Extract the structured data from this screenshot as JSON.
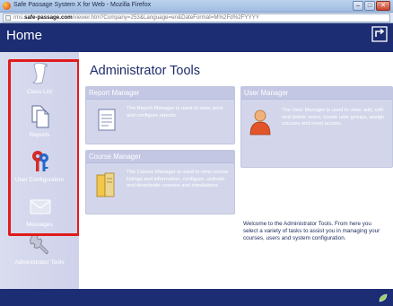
{
  "window": {
    "title": "Safe Passage System X for Web - Mozilla Firefox",
    "buttons": [
      "–",
      "□",
      "✕"
    ]
  },
  "urlbar": {
    "prefix": "rms.",
    "domain": "safe-passage.com",
    "path": "/viewer.htm?Company=253&Language=en&DateFormat=M%2Fd%2FYYYY"
  },
  "header": {
    "title": "Home",
    "exit_icon": "exit-arrow-icon"
  },
  "sidebar": {
    "items": [
      {
        "label": "Class List",
        "icon": "scroll-icon"
      },
      {
        "label": "Reports",
        "icon": "documents-icon"
      },
      {
        "label": "User Configuration",
        "icon": "users-keys-icon"
      },
      {
        "label": "Messages",
        "icon": "envelope-icon"
      },
      {
        "label": "Administrator Tools",
        "icon": "wrench-icon"
      }
    ]
  },
  "main": {
    "title": "Administrator Tools",
    "panels": {
      "report": {
        "title": "Report Manager",
        "text": "The Report Manager is used to view, print and configure reports."
      },
      "user": {
        "title": "User Manager",
        "text": "The User Manager is used to view, add, edit and delete users, create user groups, assign courses and reset access."
      },
      "course": {
        "title": "Course Manager",
        "text": "The Course Manager is used to view course listings and information, configure, activate and deactivate courses and simulations."
      }
    },
    "welcome": "Welcome to the Administrator Tools. From here you select a variety of tasks to assist you in managing your courses, users and system configuration."
  },
  "colors": {
    "header_bg": "#1c2d73",
    "sidebar_bg": "#d5d8ed",
    "panel_bg": "#d3d6ea",
    "highlight": "#e01b1b",
    "title_text": "#1f2c6a"
  }
}
